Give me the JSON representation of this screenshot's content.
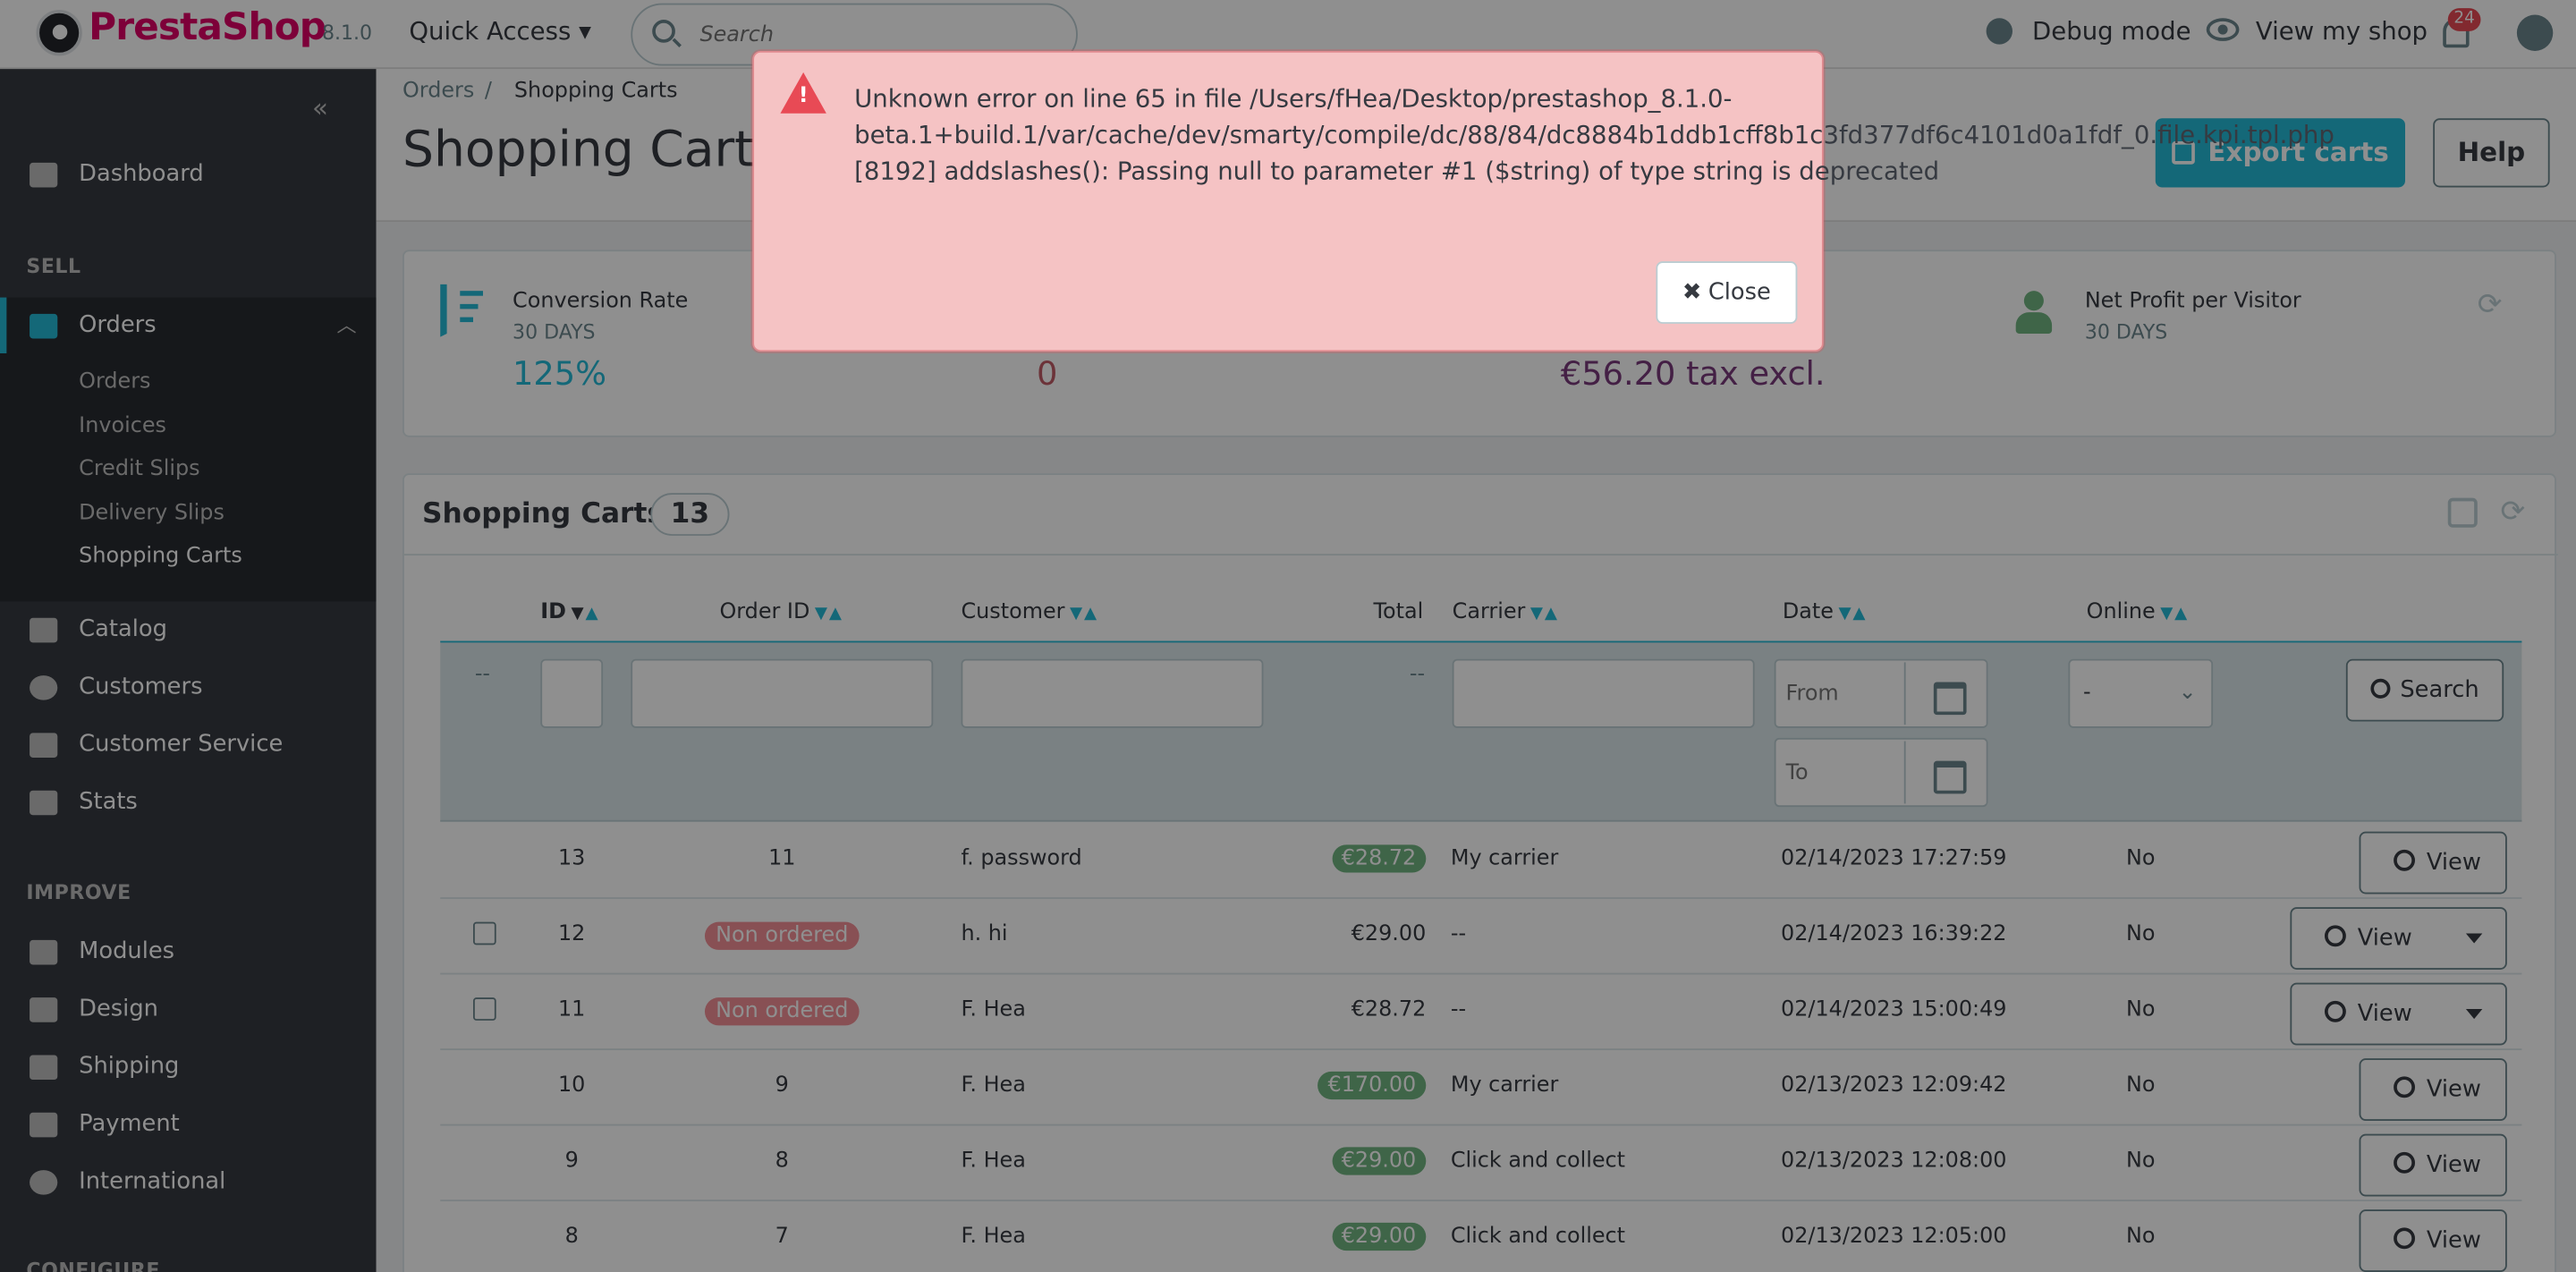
{
  "header": {
    "brand": "PrestaShop",
    "version": "8.1.0",
    "quick_access": "Quick Access ▾",
    "search_placeholder": "Search",
    "debug_mode": "Debug mode",
    "view_my_shop": "View my shop",
    "notifications": "24"
  },
  "sidebar": {
    "collapse_icon": "«",
    "items": {
      "dashboard": "Dashboard",
      "sell_section": "SELL",
      "orders": "Orders",
      "orders_sub": [
        "Orders",
        "Invoices",
        "Credit Slips",
        "Delivery Slips",
        "Shopping Carts"
      ],
      "catalog": "Catalog",
      "customers": "Customers",
      "customer_service": "Customer Service",
      "stats": "Stats",
      "improve_section": "IMPROVE",
      "modules": "Modules",
      "design": "Design",
      "shipping": "Shipping",
      "payment": "Payment",
      "international": "International",
      "configure_section": "CONFIGURE"
    }
  },
  "page": {
    "breadcrumb_parent": "Orders",
    "breadcrumb_sep": "/",
    "breadcrumb_current": "Shopping Carts",
    "title": "Shopping Carts",
    "export_label": "Export carts",
    "help_label": "Help"
  },
  "kpis": [
    {
      "title": "Conversion Rate",
      "subtitle": "30 DAYS",
      "value": "125%"
    },
    {
      "value": "0"
    },
    {
      "value": "€56.20 tax excl."
    },
    {
      "title": "Net Profit per Visitor",
      "subtitle": "30 DAYS"
    }
  ],
  "list": {
    "title": "Shopping Carts",
    "count": "13",
    "columns": [
      "ID",
      "Order ID",
      "Customer",
      "Total",
      "Carrier",
      "Date",
      "Online"
    ],
    "filters": {
      "id_dash": "--",
      "total_dash": "--",
      "date_from_placeholder": "From",
      "date_to_placeholder": "To",
      "online_value": "-",
      "search_label": "Search"
    },
    "rows": [
      {
        "id": "13",
        "order_id": "11",
        "customer": "f. password",
        "total": "€28.72",
        "carrier": "My carrier",
        "date": "02/14/2023 17:27:59",
        "online": "No",
        "view": "View"
      },
      {
        "id": "12",
        "order_id": "Non ordered",
        "customer": "h. hi",
        "total": "€29.00",
        "carrier": "--",
        "date": "02/14/2023 16:39:22",
        "online": "No",
        "view": "View"
      },
      {
        "id": "11",
        "order_id": "Non ordered",
        "customer": "F. Hea",
        "total": "€28.72",
        "carrier": "--",
        "date": "02/14/2023 15:00:49",
        "online": "No",
        "view": "View"
      },
      {
        "id": "10",
        "order_id": "9",
        "customer": "F. Hea",
        "total": "€170.00",
        "carrier": "My carrier",
        "date": "02/13/2023 12:09:42",
        "online": "No",
        "view": "View"
      },
      {
        "id": "9",
        "order_id": "8",
        "customer": "F. Hea",
        "total": "€29.00",
        "carrier": "Click and collect",
        "date": "02/13/2023 12:08:00",
        "online": "No",
        "view": "View"
      },
      {
        "id": "8",
        "order_id": "7",
        "customer": "F. Hea",
        "total": "€29.00",
        "carrier": "Click and collect",
        "date": "02/13/2023 12:05:00",
        "online": "No",
        "view": "View"
      }
    ]
  },
  "error_modal": {
    "message": "Unknown error on line 65 in file /Users/fHea/Desktop/prestashop_8.1.0-beta.1+build.1/var/cache/dev/smarty/compile/dc/88/84/dc8884b1ddb1cff8b1c3fd377df6c4101d0a1fdf_0.file.kpi.tpl.php [8192] addslashes(): Passing null to parameter #1 ($string) of type string is deprecated",
    "close_label": "Close"
  },
  "colors": {
    "brand_pink": "#df0067",
    "accent": "#25b9d7",
    "sidebar": "#363a41",
    "error_bg": "#f5c3c4",
    "success_pill": "#70b580",
    "danger_pill": "#f38f96"
  },
  "icons": [
    "search-icon",
    "bug-icon",
    "eye-icon",
    "bell-icon",
    "user-icon",
    "chart-icon",
    "basket-icon",
    "store-icon",
    "person-icon",
    "chat-icon",
    "bar-chart-icon",
    "puzzle-icon",
    "monitor-icon",
    "truck-icon",
    "card-icon",
    "globe-icon",
    "warning-icon",
    "calendar-icon",
    "magnifier-icon",
    "refresh-icon"
  ]
}
